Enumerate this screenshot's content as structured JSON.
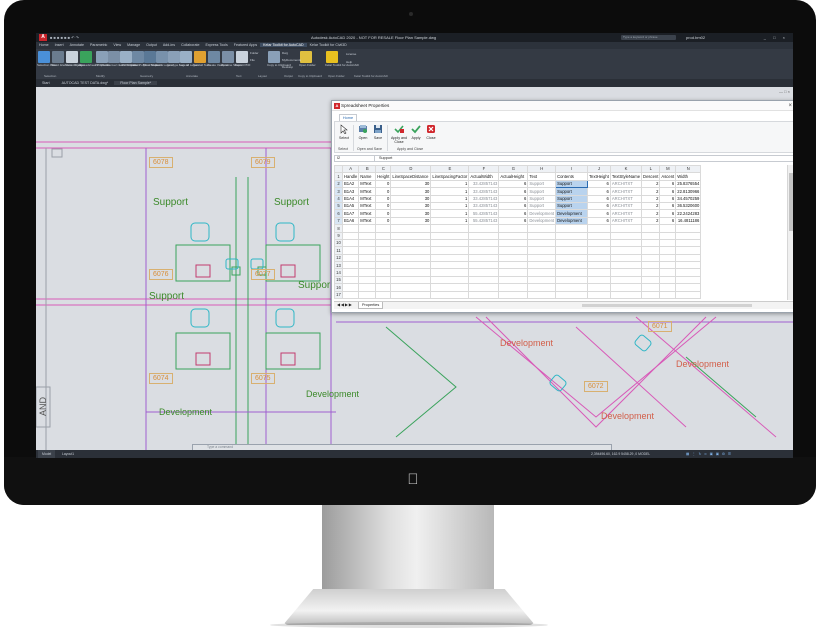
{
  "app": {
    "title": "Autodesk AutoCAD 2020 - NOT FOR RESALE   Floor Plan Sample.dwg",
    "search_placeholder": "Type a keyword or phrase",
    "user": "prod.bm02",
    "ribbon_tabs": [
      "Home",
      "Insert",
      "Annotate",
      "Parametric",
      "View",
      "Manage",
      "Output",
      "Add-ins",
      "Collaborate",
      "Express Tools",
      "Featured Apps",
      "Kelar Toolkit for AutoCAD",
      "Kelar Toolkit for Civil3D"
    ],
    "active_ribbon_tab": "Kelar Toolkit for AutoCAD",
    "ribbon_tools": [
      {
        "label": "Selection Filter",
        "color": "#4a90d9"
      },
      {
        "label": "Select Elements on Layer",
        "color": "#6b7c8f"
      },
      {
        "label": "Show Object",
        "color": "#c9d2dc"
      },
      {
        "label": "Spreadsheet Properties",
        "color": "#3aa35c"
      },
      {
        "label": "2D Offset",
        "color": "#8aa0b8"
      },
      {
        "label": "Convert to 2D Polyline",
        "color": "#7b8fa6"
      },
      {
        "label": "Label Elevation",
        "color": "#9ab0c6"
      },
      {
        "label": "Label Polyline Slope",
        "color": "#6e88a3"
      },
      {
        "label": "Block Measure",
        "color": "#5a7896"
      },
      {
        "label": "Hatch Legend",
        "color": "#7891ab"
      },
      {
        "label": "Linetype Legend",
        "color": "#8aa0b8"
      },
      {
        "label": "Sum all Legend",
        "color": "#9ab0c6"
      },
      {
        "label": "Sum all Texts",
        "color": "#e0a030"
      },
      {
        "label": "Create Viewport",
        "color": "#6e88a3"
      },
      {
        "label": "Rename Sheets",
        "color": "#7b8fa6"
      },
      {
        "label": "Export PDF",
        "color": "#c9d2dc"
      },
      {
        "label": "Copy to Clipboard",
        "color": "#8aa0b8"
      },
      {
        "label": "Open Folder",
        "color": "#e0c040"
      },
      {
        "label": "Kelar Toolkit for AutoCAD",
        "color": "#e8c020"
      }
    ],
    "ribbon_small": [
      "Folder",
      "File",
      "Dwg",
      "MyDocuments",
      "Desktop",
      "License",
      "Help"
    ],
    "ribbon_panels": [
      "Selection",
      "Modify",
      "Geometry",
      "Annotate",
      "Text",
      "Layout",
      "Output",
      "Copy to Clipboard",
      "Open Folder",
      "Kelar Toolkit for AutoCAD"
    ],
    "doc_tabs": [
      "Start",
      "AUTOCAD TEST DATA.dwg*",
      "Floor Plan Sample*"
    ],
    "active_doc_tab": "Floor Plan Sample*",
    "command_placeholder": "Type a command",
    "layout_tabs": [
      "Model",
      "Layout1"
    ],
    "status_text": "2,394496.60, 162.9 5458.29 ,0   MODEL",
    "accent_color": "#3d4c60"
  },
  "drawing": {
    "labels_support": [
      "Support",
      "Support",
      "Support",
      "Suppor"
    ],
    "labels_development": [
      "Development",
      "Development"
    ],
    "labels_development_red": [
      "Development",
      "Development",
      "Development"
    ],
    "room_numbers": [
      "6078",
      "6079",
      "6076",
      "6077",
      "6074",
      "6075",
      "6071",
      "6072"
    ],
    "north_label": "AND"
  },
  "dialog": {
    "title": "Spreadsheet Properties",
    "tab": "Home",
    "tools": [
      {
        "label": "Select",
        "icon": "cursor-icon"
      },
      {
        "label": "Open",
        "icon": "open-icon"
      },
      {
        "label": "Save",
        "icon": "save-icon"
      },
      {
        "label": "Apply and Close",
        "icon": "apply-close-icon"
      },
      {
        "label": "Apply",
        "icon": "check-icon"
      },
      {
        "label": "Close",
        "icon": "close-red-icon"
      }
    ],
    "groups": [
      "Select",
      "Open and Save",
      "Apply and Close"
    ],
    "cell_ref": "I2",
    "formula_value": "Support",
    "columns": [
      "",
      "A",
      "B",
      "C",
      "D",
      "E",
      "F",
      "G",
      "H",
      "I",
      "J",
      "K",
      "L",
      "M",
      "N"
    ],
    "headers": [
      "Handle",
      "Name",
      "Height",
      "LineSpaceDistance",
      "LineSpacingFactor",
      "ActualWidth",
      "ActualHeight",
      "Text",
      "Contents",
      "TextHeight",
      "TextStyleName",
      "Descent",
      "Ascent",
      "Width"
    ],
    "rows": [
      [
        "B1A2",
        "MText",
        "0",
        "30",
        "1",
        "33.42857143",
        "6",
        "Support",
        "Support",
        "6",
        "ARCHITXT",
        "2",
        "6",
        "25.8376554"
      ],
      [
        "B1A3",
        "MText",
        "0",
        "30",
        "1",
        "33.42857143",
        "6",
        "Support",
        "Support",
        "6",
        "ARCHITXT",
        "2",
        "6",
        "22.8130966"
      ],
      [
        "B1A4",
        "MText",
        "0",
        "30",
        "1",
        "33.42857143",
        "6",
        "Support",
        "Support",
        "6",
        "ARCHITXT",
        "2",
        "6",
        "34.4570259"
      ],
      [
        "B1A5",
        "MText",
        "0",
        "30",
        "1",
        "33.42857143",
        "6",
        "Support",
        "Support",
        "6",
        "ARCHITXT",
        "2",
        "6",
        "36.5320600"
      ],
      [
        "B1A7",
        "MText",
        "0",
        "30",
        "1",
        "55.42857143",
        "6",
        "Development",
        "Development",
        "6",
        "ARCHITXT",
        "2",
        "6",
        "22.2424283"
      ],
      [
        "B1A6",
        "MText",
        "0",
        "30",
        "1",
        "55.42857143",
        "6",
        "Development",
        "Development",
        "6",
        "ARCHITXT",
        "2",
        "6",
        "16.4811186"
      ]
    ],
    "empty_row_numbers": [
      "8",
      "9",
      "10",
      "11",
      "12",
      "13",
      "14",
      "15",
      "16",
      "17"
    ],
    "sheet_tab": "Properties"
  }
}
